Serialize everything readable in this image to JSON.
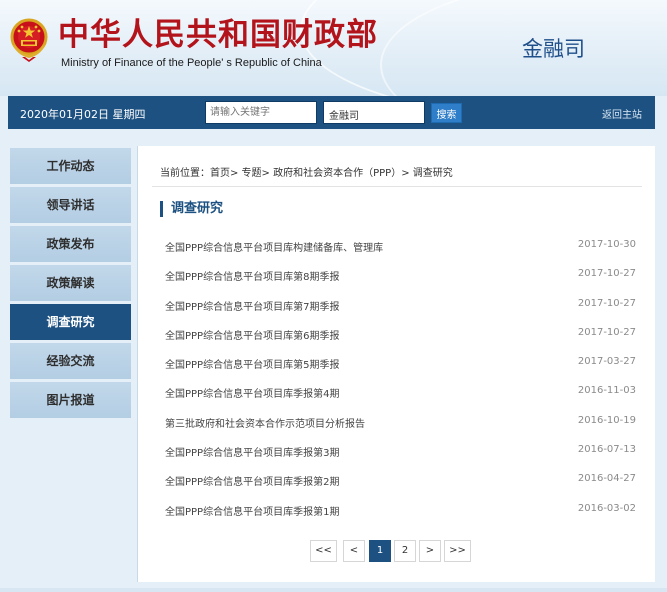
{
  "header": {
    "title_cn": "中华人民共和国财政部",
    "title_en": "Ministry of Finance of the People' s Republic of China",
    "dept": "金融司"
  },
  "topbar": {
    "date": "2020年01月02日  星期四",
    "search_placeholder": "请输入关键字",
    "scope": "金融司",
    "search_label": "搜索",
    "home_label": "返回主站"
  },
  "sidebar": {
    "items": [
      {
        "label": "工作动态"
      },
      {
        "label": "领导讲话"
      },
      {
        "label": "政策发布"
      },
      {
        "label": "政策解读"
      },
      {
        "label": "调查研究"
      },
      {
        "label": "经验交流"
      },
      {
        "label": "图片报道"
      }
    ]
  },
  "main": {
    "breadcrumb": "当前位置：首页> 专题> 政府和社会资本合作（PPP）> 调查研究",
    "section_title": "调查研究",
    "articles": [
      {
        "title": "全国PPP综合信息平台项目库构建储备库、管理库",
        "date": "2017-10-30"
      },
      {
        "title": "全国PPP综合信息平台项目库第8期季报",
        "date": "2017-10-27"
      },
      {
        "title": "全国PPP综合信息平台项目库第7期季报",
        "date": "2017-10-27"
      },
      {
        "title": "全国PPP综合信息平台项目库第6期季报",
        "date": "2017-10-27"
      },
      {
        "title": "全国PPP综合信息平台项目库第5期季报",
        "date": "2017-03-27"
      },
      {
        "title": "全国PPP综合信息平台项目库季报第4期",
        "date": "2016-11-03"
      },
      {
        "title": "第三批政府和社会资本合作示范项目分析报告",
        "date": "2016-10-19"
      },
      {
        "title": "全国PPP综合信息平台项目库季报第3期",
        "date": "2016-07-13"
      },
      {
        "title": "全国PPP综合信息平台项目库季报第2期",
        "date": "2016-04-27"
      },
      {
        "title": "全国PPP综合信息平台项目库季报第1期",
        "date": "2016-03-02"
      }
    ],
    "pagination": {
      "first": "<<",
      "prev": "<",
      "pages": [
        "1",
        "2"
      ],
      "next": ">",
      "last": ">>"
    }
  },
  "colors": {
    "brand_red": "#b3141b",
    "nav_blue": "#1c5181",
    "sidebar_light": "#c2d8ea"
  }
}
